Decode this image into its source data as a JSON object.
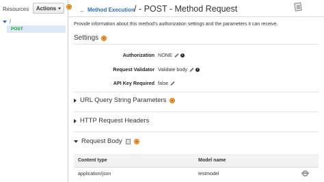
{
  "sidebar": {
    "title": "Resources",
    "actions_label": "Actions",
    "tree_root": "/",
    "tree_method": "POST"
  },
  "header": {
    "back_label": "Method Execution",
    "title": "/ - POST - Method Request"
  },
  "description": "Provide information about this method's authorization settings and the parameters it can receive.",
  "settings": {
    "heading": "Settings",
    "fields": [
      {
        "label": "Authorization",
        "value": "NONE"
      },
      {
        "label": "Request Validator",
        "value": "Validate body"
      },
      {
        "label": "API Key Required",
        "value": "false"
      }
    ]
  },
  "sections": {
    "url_query": "URL Query String Parameters",
    "http_headers": "HTTP Request Headers",
    "request_body": "Request Body"
  },
  "body_table": {
    "headers": [
      "Content type",
      "Model name"
    ],
    "rows": [
      {
        "content_type": "application/json",
        "model_name": "testmodel"
      }
    ]
  },
  "colors": {
    "link": "#2a6ebb",
    "method_green": "#1a9e2a",
    "help_orange": "#f0a23e",
    "selected_bg": "#dde9f6"
  },
  "icons": [
    "chevron-down-icon",
    "help-icon",
    "back-arrow-icon",
    "document-icon",
    "pencil-icon",
    "info-icon",
    "expand-right-icon",
    "collapse-down-icon",
    "gear-icon"
  ]
}
